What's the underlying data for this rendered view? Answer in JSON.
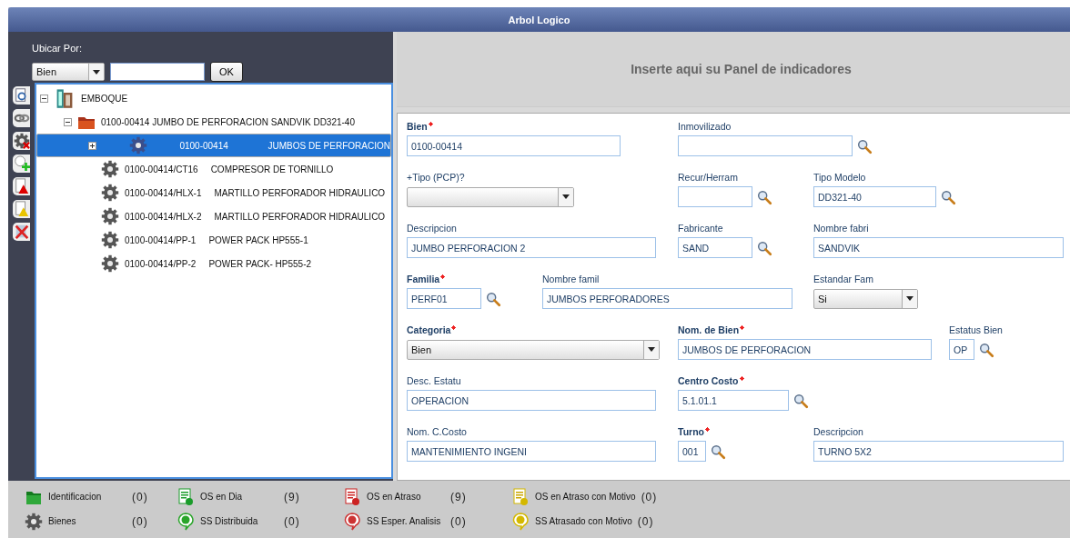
{
  "window": {
    "title": "Arbol Logico"
  },
  "locator": {
    "label": "Ubicar Por:",
    "type_value": "Bien",
    "button": "OK"
  },
  "side_tools": [
    {
      "kind": "search"
    },
    {
      "kind": "link"
    },
    {
      "kind": "gear-delete"
    },
    {
      "kind": "ss-add"
    },
    {
      "kind": "doc-red"
    },
    {
      "kind": "doc-yellow"
    },
    {
      "kind": "delete"
    }
  ],
  "tree": [
    {
      "kind": "site",
      "label": "EMBOQUE",
      "expanded": true,
      "selected": false,
      "children": [
        {
          "kind": "folder",
          "label": "0100-00414 JUMBO DE PERFORACION SANDVIK DD321-40",
          "expanded": true,
          "selected": false,
          "children": [
            {
              "kind": "asset",
              "code": "0100-00414",
              "label": "JUMBOS DE PERFORACION",
              "expanded": false,
              "selected": true
            },
            {
              "kind": "asset",
              "code": "0100-00414/CT16",
              "label": "COMPRESOR DE TORNILLO",
              "selected": false
            },
            {
              "kind": "asset",
              "code": "0100-00414/HLX-1",
              "label": "MARTILLO PERFORADOR HIDRAULICO",
              "selected": false
            },
            {
              "kind": "asset",
              "code": "0100-00414/HLX-2",
              "label": "MARTILLO PERFORADOR HIDRAULICO",
              "selected": false
            },
            {
              "kind": "asset",
              "code": "0100-00414/PP-1",
              "label": "POWER PACK HP555-1",
              "selected": false
            },
            {
              "kind": "asset",
              "code": "0100-00414/PP-2",
              "label": "POWER PACK- HP555-2",
              "selected": false
            }
          ]
        }
      ]
    }
  ],
  "indicator_panel": {
    "text": "Inserte aqui su Panel de indicadores"
  },
  "form_rows": [
    [
      {
        "label": "Bien",
        "required": true,
        "kind": "text",
        "value": "0100-00414"
      },
      {
        "label": "Inmovilizado",
        "required": false,
        "kind": "lookup"
      }
    ],
    [
      {
        "label": "+Tipo (PCP)?",
        "required": false,
        "kind": "select"
      },
      {
        "label": "Recur/Herram",
        "required": false,
        "kind": "lookup"
      },
      {
        "label": "Tipo Modelo",
        "required": false,
        "kind": "lookup",
        "value": "DD321-40"
      }
    ],
    [
      {
        "label": "Descripcion",
        "required": false,
        "kind": "text",
        "value": "JUMBO PERFORACION 2"
      },
      {
        "label": "Fabricante",
        "required": false,
        "kind": "lookup",
        "value": "SAND"
      },
      {
        "label": "Nombre fabri",
        "required": false,
        "kind": "text",
        "value": "SANDVIK"
      }
    ],
    [
      {
        "label": "Familia",
        "required": true,
        "kind": "lookup",
        "value": "PERF01"
      },
      {
        "label": "Nombre famil",
        "required": false,
        "kind": "text",
        "value": "JUMBOS PERFORADORES"
      },
      {
        "label": "Estandar Fam",
        "required": false,
        "kind": "select",
        "value": "Si"
      }
    ],
    [
      {
        "label": "Categoria",
        "required": true,
        "kind": "select",
        "value": "Bien"
      },
      {
        "label": "Nom. de Bien",
        "required": true,
        "kind": "text",
        "value": "JUMBOS DE PERFORACION"
      },
      {
        "label": "Estatus Bien",
        "required": false,
        "kind": "lookup",
        "value": "OP"
      }
    ],
    [
      {
        "label": "Desc. Estatu",
        "required": false,
        "kind": "text",
        "value": "OPERACION"
      },
      {
        "label": "Centro Costo",
        "required": true,
        "kind": "lookup",
        "value": "5.1.01.1"
      }
    ],
    [
      {
        "label": "Nom. C.Costo",
        "required": false,
        "kind": "text",
        "value": "MANTENIMIENTO INGENI"
      },
      {
        "label": "Turno",
        "required": true,
        "kind": "lookup",
        "value": "001"
      },
      {
        "label": "Descripcion",
        "required": false,
        "kind": "text",
        "value": "TURNO 5X2"
      }
    ]
  ],
  "legend": [
    {
      "kind": "identification",
      "label": "Identificacion",
      "count": "(0)"
    },
    {
      "kind": "os-on-time",
      "label": "OS en Dia",
      "count": "(9)"
    },
    {
      "kind": "os-late",
      "label": "OS en Atraso",
      "count": "(9)"
    },
    {
      "kind": "os-late-reason",
      "label": "OS en Atraso con Motivo",
      "count": "(0)"
    },
    {
      "kind": "assets",
      "label": "Bienes",
      "count": "(0)"
    },
    {
      "kind": "ss-distributed",
      "label": "SS Distribuida",
      "count": "(0)"
    },
    {
      "kind": "ss-waiting",
      "label": "SS Esper. Analisis",
      "count": "(0)"
    },
    {
      "kind": "ss-late-reason",
      "label": "SS Atrasado con Motivo",
      "count": "(0)"
    }
  ]
}
